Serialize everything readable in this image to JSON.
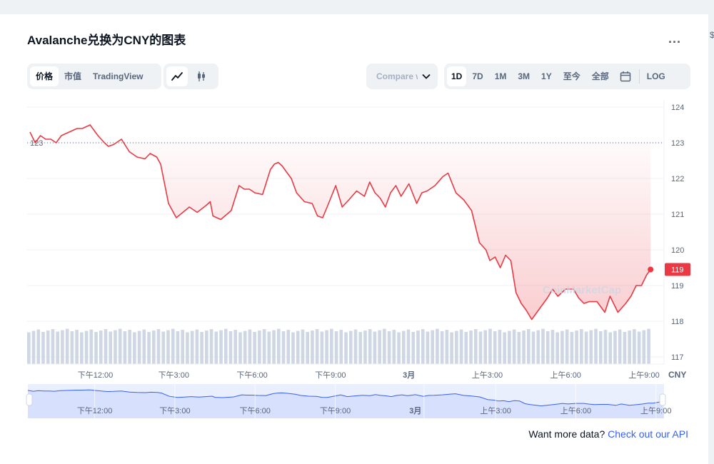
{
  "page": {
    "title": "Avalanche兑换为CNY的图表",
    "more_label": "...",
    "edge_glyph": "$"
  },
  "toolbar": {
    "type_tabs": [
      "价格",
      "市值",
      "TradingView"
    ],
    "active_type": "价格",
    "chart_style_icons": [
      "line-chart-icon",
      "candlestick-icon"
    ],
    "active_style": "line-chart-icon",
    "compare_label": "Compare with",
    "ranges": [
      "1D",
      "7D",
      "1M",
      "3M",
      "1Y",
      "至今",
      "全部"
    ],
    "active_range": "1D",
    "calendar_icon": "calendar-icon",
    "log_label": "LOG"
  },
  "footer": {
    "prefix": "Want more data?",
    "link": "Check out our API"
  },
  "colors": {
    "line": "#ea3943",
    "accent_link": "#3861fb",
    "navigator_line": "#3861fb",
    "muted": "#58667e"
  },
  "chart_data": {
    "type": "line",
    "currency_label": "CNY",
    "y_ticks": [
      124,
      123,
      122,
      121,
      120,
      119,
      118,
      117
    ],
    "ylim": [
      116.8,
      124.2
    ],
    "open_reference": 123,
    "open_reference_label": "123",
    "last_price_label": "119",
    "x_tick_labels": [
      "下午12:00",
      "下午3:00",
      "下午6:00",
      "下午9:00",
      "3月",
      "上午3:00",
      "上午6:00",
      "上午9:00"
    ],
    "x_ticks": [
      2.5,
      5.5,
      8.5,
      11.5,
      14.5,
      17.5,
      20.5,
      23.5
    ],
    "xlim": [
      0,
      23.8
    ],
    "series": [
      {
        "x": [
          0,
          0.2,
          0.4,
          0.6,
          0.8,
          1.0,
          1.2,
          1.5,
          1.8,
          2.0,
          2.3,
          2.6,
          2.85,
          3.0,
          3.2,
          3.5,
          3.8,
          4.1,
          4.4,
          4.6,
          4.85,
          5.0,
          5.3,
          5.6,
          5.85,
          6.1,
          6.4,
          6.75,
          6.9,
          7.0,
          7.3,
          7.7,
          8.0,
          8.2,
          8.4,
          8.6,
          8.9,
          9.2,
          9.35,
          9.5,
          9.65,
          9.8,
          10.0,
          10.2,
          10.5,
          10.8,
          11.0,
          11.2,
          11.4,
          11.7,
          11.95,
          12.2,
          12.5,
          12.8,
          13.0,
          13.2,
          13.4,
          13.6,
          13.8,
          14.0,
          14.2,
          14.5,
          14.8,
          15.0,
          15.2,
          15.5,
          15.8,
          16.0,
          16.3,
          16.6,
          16.9,
          17.2,
          17.45,
          17.6,
          17.8,
          18.0,
          18.2,
          18.4,
          18.6,
          18.8,
          19.0,
          19.2,
          19.5,
          19.8,
          20.0,
          20.2,
          20.5,
          20.8,
          21.0,
          21.2,
          21.4,
          21.7,
          22.0,
          22.2,
          22.5,
          22.8,
          23.0,
          23.2,
          23.4,
          23.6,
          23.75
        ],
        "y": [
          123.3,
          123.0,
          123.2,
          123.1,
          123.1,
          123.0,
          123.2,
          123.3,
          123.4,
          123.4,
          123.5,
          123.2,
          123.0,
          122.9,
          122.95,
          123.1,
          122.75,
          122.6,
          122.55,
          122.7,
          122.6,
          122.4,
          121.3,
          120.9,
          121.05,
          121.2,
          121.05,
          121.25,
          121.35,
          120.95,
          120.85,
          121.1,
          121.8,
          121.7,
          121.7,
          121.6,
          121.55,
          122.25,
          122.4,
          122.45,
          122.35,
          122.2,
          122.0,
          121.6,
          121.35,
          121.3,
          120.95,
          120.9,
          121.25,
          121.8,
          121.2,
          121.4,
          121.65,
          121.5,
          121.9,
          121.6,
          121.45,
          121.2,
          121.6,
          121.8,
          121.5,
          121.85,
          121.3,
          121.6,
          121.65,
          121.8,
          122.05,
          122.15,
          121.6,
          121.4,
          121.1,
          120.2,
          120.0,
          119.7,
          119.8,
          119.5,
          119.85,
          119.7,
          118.8,
          118.5,
          118.3,
          118.05,
          118.35,
          118.65,
          118.9,
          118.7,
          118.9,
          118.9,
          118.65,
          118.5,
          118.55,
          118.55,
          118.25,
          118.7,
          118.25,
          118.5,
          118.7,
          119.0,
          119.0,
          119.3,
          119.45
        ],
        "line_color": "#ea3943"
      }
    ],
    "volume_bar_count": 130,
    "volume_relative_level": 0.95,
    "navigator": {
      "x_tick_labels": [
        "下午12:00",
        "下午3:00",
        "下午6:00",
        "下午9:00",
        "3月",
        "上午3:00",
        "上午6:00",
        "上午9:00"
      ]
    },
    "watermark": "CoinMarketCap"
  }
}
